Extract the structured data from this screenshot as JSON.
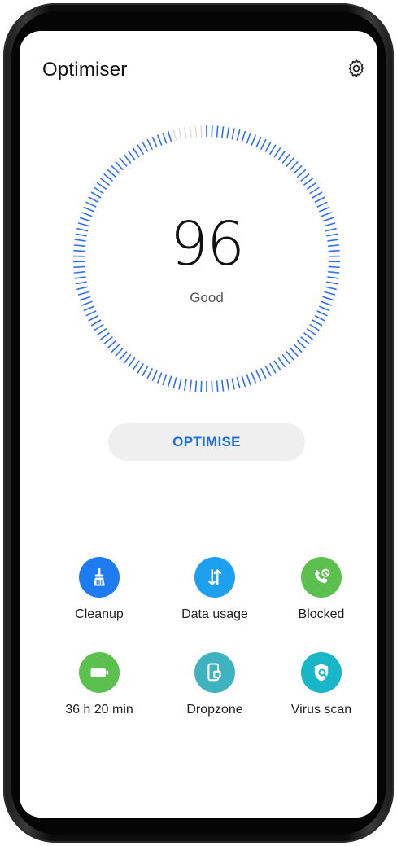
{
  "header": {
    "title": "Optimiser",
    "settings_icon": "gear-icon"
  },
  "status": {
    "score": "96",
    "rating": "Good",
    "gauge_fill_fraction": 0.96
  },
  "actions": {
    "optimise_label": "OPTIMISE"
  },
  "tools": [
    {
      "label": "Cleanup",
      "icon": "broom-icon",
      "color": "#1e7bf0"
    },
    {
      "label": "Data usage",
      "icon": "data-transfer-icon",
      "color": "#1ea0f0"
    },
    {
      "label": "Blocked",
      "icon": "blocked-call-icon",
      "color": "#5cc04e"
    },
    {
      "label": "36 h 20 min",
      "icon": "battery-icon",
      "color": "#5cc04e"
    },
    {
      "label": "Dropzone",
      "icon": "dropzone-icon",
      "color": "#3fb2c0"
    },
    {
      "label": "Virus scan",
      "icon": "virus-scan-icon",
      "color": "#18b6c8"
    }
  ],
  "colors": {
    "accent": "#1f6fe0",
    "gauge_active": "#2f6ff0",
    "gauge_inactive": "#dcdcdc"
  }
}
